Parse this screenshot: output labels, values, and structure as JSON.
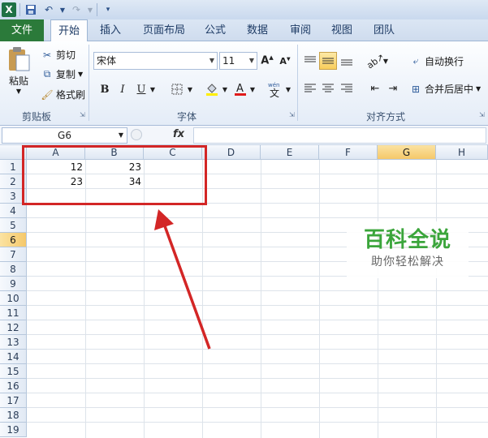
{
  "quick_access": {
    "icons": [
      "excel-logo-icon",
      "save-icon",
      "undo-icon",
      "redo-icon",
      "customize-icon"
    ]
  },
  "tabs": [
    "文件",
    "开始",
    "插入",
    "页面布局",
    "公式",
    "数据",
    "审阅",
    "视图",
    "团队"
  ],
  "active_tab": "开始",
  "clipboard": {
    "paste": "粘贴",
    "cut": "剪切",
    "copy": "复制",
    "format_painter": "格式刷",
    "label": "剪贴板"
  },
  "font": {
    "name": "宋体",
    "size": "11",
    "label": "字体",
    "bold": "B",
    "italic": "I",
    "underline": "U"
  },
  "alignment": {
    "wrap": "自动换行",
    "merge": "合并后居中",
    "label": "对齐方式"
  },
  "formula_bar": {
    "name_box": "G6",
    "fx": "fx",
    "formula": ""
  },
  "columns": [
    "A",
    "B",
    "C",
    "D",
    "E",
    "F",
    "G",
    "H"
  ],
  "selected_column": "G",
  "rows": [
    "1",
    "2",
    "3",
    "4",
    "5",
    "6",
    "7",
    "8",
    "9",
    "10",
    "11",
    "12",
    "13",
    "14",
    "15",
    "16",
    "17",
    "18",
    "19"
  ],
  "selected_row": "6",
  "cells": {
    "A1": "12",
    "B1": "23",
    "A2": "23",
    "B2": "34"
  },
  "watermark": {
    "title": "百科全说",
    "subtitle": "助你轻松解决"
  },
  "colors": {
    "accent_file": "#2b7a3a",
    "highlight": "#d32626",
    "watermark_green": "#3ba53b"
  }
}
